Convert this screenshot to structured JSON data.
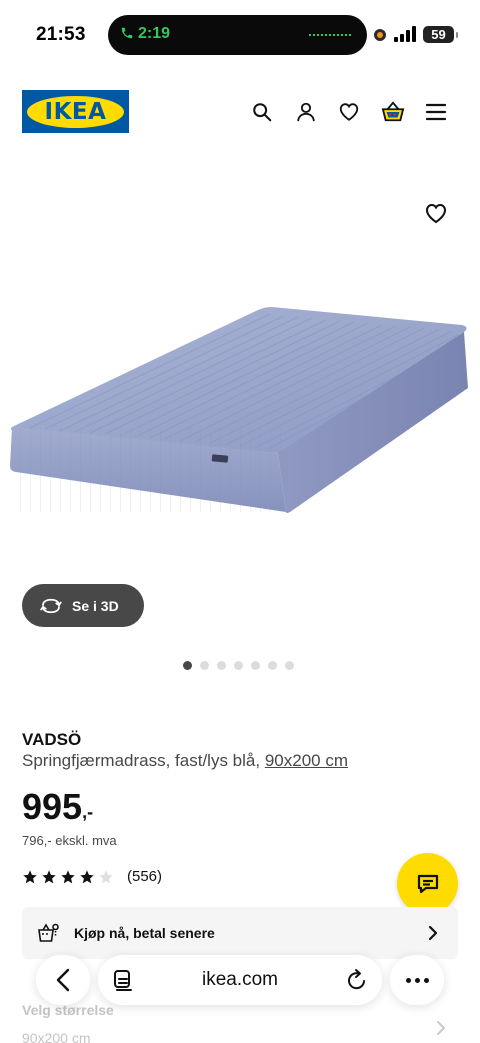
{
  "status_bar": {
    "time": "21:53",
    "call_timer": "2:19",
    "battery": "59",
    "call_color": "#34c759"
  },
  "header": {
    "logo_text": "IKEA",
    "brand_blue": "#0058a3",
    "brand_yellow": "#ffdb00",
    "icons": [
      "search-icon",
      "account-icon",
      "heart-icon",
      "shopping-basket-icon",
      "menu-icon"
    ]
  },
  "gallery": {
    "view_3d_label": "Se i 3D",
    "image_count": 7,
    "active_index": 0
  },
  "product": {
    "name": "VADSÖ",
    "description": "Springfjærmadrass, fast/lys blå,",
    "size_link": "90x200 cm",
    "price": "995",
    "price_suffix": ",-",
    "price_ex_vat": "796,- ekskl. mva",
    "rating_stars": 4,
    "rating_max": 5,
    "review_count": "(556)"
  },
  "payment_banner": {
    "label": "Kjøp nå, betal senere"
  },
  "size_selector": {
    "label": "Velg størrelse",
    "value": "90x200 cm"
  },
  "browser": {
    "url": "ikea.com"
  }
}
